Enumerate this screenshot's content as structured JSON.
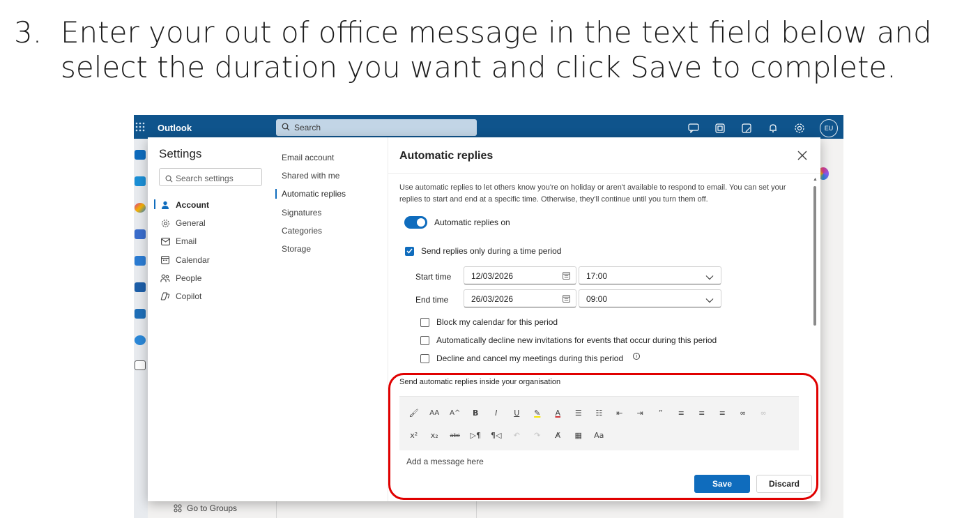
{
  "instruction": {
    "number": "3.",
    "text": "Enter your out of office message in the text field below and select the duration you want and click Save to complete."
  },
  "app": {
    "brand": "Outlook",
    "search_placeholder": "Search",
    "avatar_initials": "EU",
    "accent_color": "#0f548c",
    "primary_color": "#0f6cbd",
    "highlight_color": "#e00000"
  },
  "background": {
    "groups_link": "Go to Groups"
  },
  "settings": {
    "title": "Settings",
    "search_placeholder": "Search settings",
    "categories": [
      {
        "label": "Account",
        "icon": "person-icon",
        "active": true
      },
      {
        "label": "General",
        "icon": "gear-icon",
        "active": false
      },
      {
        "label": "Email",
        "icon": "mail-icon",
        "active": false
      },
      {
        "label": "Calendar",
        "icon": "calendar-icon",
        "active": false
      },
      {
        "label": "People",
        "icon": "people-icon",
        "active": false
      },
      {
        "label": "Copilot",
        "icon": "copilot-icon",
        "active": false
      }
    ],
    "subnav": [
      {
        "label": "Email account",
        "active": false
      },
      {
        "label": "Shared with me",
        "active": false
      },
      {
        "label": "Automatic replies",
        "active": true
      },
      {
        "label": "Signatures",
        "active": false
      },
      {
        "label": "Categories",
        "active": false
      },
      {
        "label": "Storage",
        "active": false
      }
    ]
  },
  "auto_replies": {
    "title": "Automatic replies",
    "description": "Use automatic replies to let others know you're on holiday or aren't available to respond to email. You can set your replies to start and end at a specific time. Otherwise, they'll continue until you turn them off.",
    "toggle_label": "Automatic replies on",
    "toggle_on": true,
    "time_period_label": "Send replies only during a time period",
    "time_period_checked": true,
    "start_label": "Start time",
    "start_date": "12/03/2026",
    "start_time": "17:00",
    "end_label": "End time",
    "end_date": "26/03/2026",
    "end_time": "09:00",
    "options": [
      {
        "label": "Block my calendar for this period",
        "checked": false
      },
      {
        "label": "Automatically decline new invitations for events that occur during this period",
        "checked": false
      },
      {
        "label": "Decline and cancel my meetings during this period",
        "checked": false
      }
    ],
    "inside_org_label": "Send automatic replies inside your organisation",
    "message_placeholder": "Add a message here",
    "save_label": "Save",
    "discard_label": "Discard"
  },
  "toolbar": {
    "row1": [
      {
        "name": "format-painter-icon",
        "glyph": "🖌"
      },
      {
        "name": "font-size-icon",
        "glyph": "AA"
      },
      {
        "name": "increase-font-icon",
        "glyph": "A^"
      },
      {
        "name": "bold-icon",
        "glyph": "B"
      },
      {
        "name": "italic-icon",
        "glyph": "I"
      },
      {
        "name": "underline-icon",
        "glyph": "U"
      },
      {
        "name": "highlight-icon",
        "glyph": "✎"
      },
      {
        "name": "font-color-icon",
        "glyph": "A"
      },
      {
        "name": "bullets-icon",
        "glyph": "☰"
      },
      {
        "name": "numbering-icon",
        "glyph": "☷"
      },
      {
        "name": "decrease-indent-icon",
        "glyph": "⇤"
      },
      {
        "name": "increase-indent-icon",
        "glyph": "⇥"
      },
      {
        "name": "quote-icon",
        "glyph": "”"
      },
      {
        "name": "align-left-icon",
        "glyph": "≡"
      },
      {
        "name": "align-center-icon",
        "glyph": "≡"
      },
      {
        "name": "align-right-icon",
        "glyph": "≡"
      },
      {
        "name": "link-icon",
        "glyph": "∞"
      },
      {
        "name": "unlink-icon",
        "glyph": "∞"
      }
    ],
    "row2": [
      {
        "name": "superscript-icon",
        "glyph": "x²"
      },
      {
        "name": "subscript-icon",
        "glyph": "x₂"
      },
      {
        "name": "strikethrough-icon",
        "glyph": "abc"
      },
      {
        "name": "ltr-icon",
        "glyph": "▷¶"
      },
      {
        "name": "rtl-icon",
        "glyph": "¶◁"
      },
      {
        "name": "undo-icon",
        "glyph": "↶"
      },
      {
        "name": "redo-icon",
        "glyph": "↷"
      },
      {
        "name": "clear-format-icon",
        "glyph": "A̸"
      },
      {
        "name": "table-icon",
        "glyph": "▦"
      },
      {
        "name": "styles-icon",
        "glyph": "Aa"
      }
    ]
  }
}
